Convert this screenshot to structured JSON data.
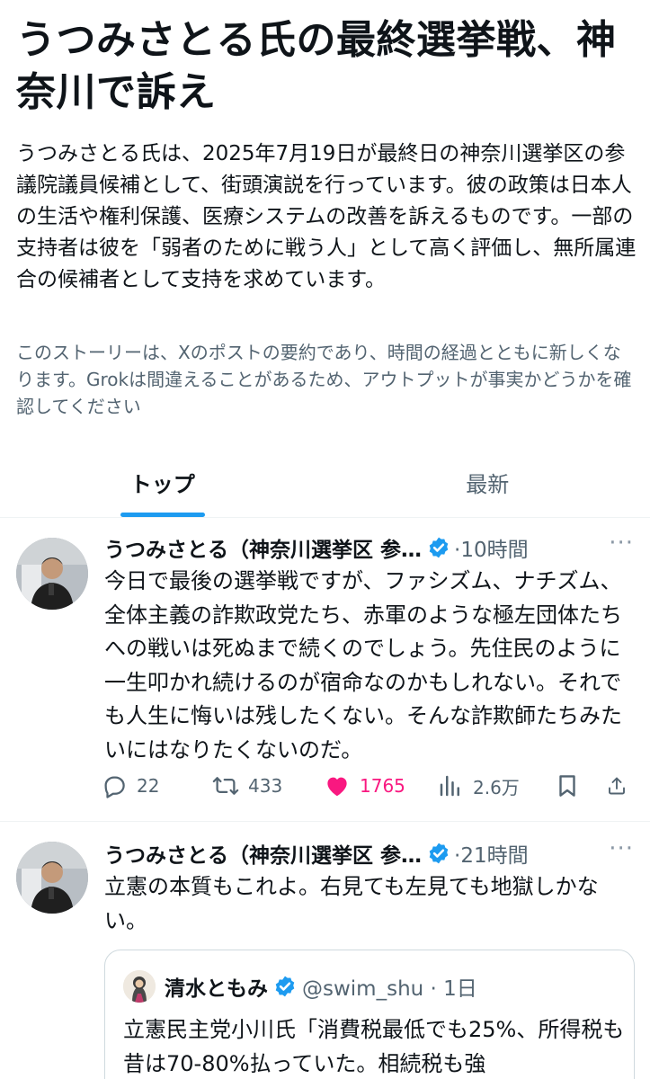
{
  "story": {
    "title": "うつみさとる氏の最終選挙戦、神奈川で訴え",
    "summary": "うつみさとる氏は、2025年7月19日が最終日の神奈川選挙区の参議院議員候補として、街頭演説を行っています。彼の政策は日本人の生活や権利保護、医療システムの改善を訴えるものです。一部の支持者は彼を「弱者のために戦う人」として高く評価し、無所属連合の候補者として支持を求めています。",
    "disclaimer": "このストーリーは、Xのポストの要約であり、時間の経過とともに新しくなります。Grokは間違えることがあるため、アウトプットが事実かどうかを確認してください"
  },
  "tabs": [
    {
      "label": "トップ",
      "active": true
    },
    {
      "label": "最新",
      "active": false
    }
  ],
  "tweets": [
    {
      "author": "うつみさとる（神奈川選挙区 参…",
      "time": "·10時間",
      "more": "···",
      "text": "今日で最後の選挙戦ですが、ファシズム、ナチズム、全体主義の詐欺政党たち、赤軍のような極左団体たちへの戦いは死ぬまで続くのでしょう。先住民のように一生叩かれ続けるのが宿命なのかもしれない。それでも人生に悔いは残したくない。そんな詐欺師たちみたいにはなりたくないのだ。",
      "replies": "22",
      "reposts": "433",
      "likes": "1765",
      "views": "2.6万"
    },
    {
      "author": "うつみさとる（神奈川選挙区 参…",
      "time": "·21時間",
      "more": "···",
      "text": "立憲の本質もこれよ。右見ても左見ても地獄しかない。",
      "quote": {
        "name": "清水ともみ",
        "handle": "@swim_shu · 1日",
        "text": "立憲民主党小川氏「消費税最低でも25%、所得税も昔は70-80%払っていた。相続税も強"
      }
    }
  ],
  "colors": {
    "accent": "#1d9bf0",
    "like": "#f91880",
    "secondary_text": "#536471",
    "verified": "#1d9bf0"
  },
  "icons": [
    "reply-icon",
    "repost-icon",
    "like-icon",
    "views-icon",
    "bookmark-icon",
    "share-icon",
    "verified-badge-icon",
    "more-icon"
  ]
}
